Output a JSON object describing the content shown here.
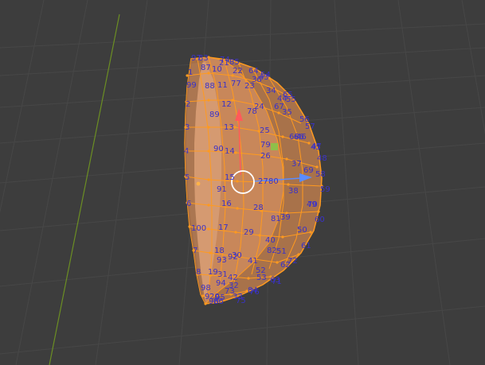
{
  "viewport": {
    "background": "#3d3d3d",
    "grid_color": "#474747",
    "y_axis_color": "#6b8e23",
    "mesh_face_color": "#c8875a",
    "mesh_edge_color": "#ff9a1f",
    "index_label_color": "#3a32c8"
  },
  "gizmo": {
    "y_arrow_color": "#ff5a5a",
    "x_arrow_color": "#5a8cff",
    "z_handle_color": "#8fbf4a",
    "cursor_ring_color": "#ffffff"
  },
  "labels": [
    {
      "t": "87"
    },
    {
      "t": "10"
    },
    {
      "t": "22"
    },
    {
      "t": "99"
    },
    {
      "t": "88"
    },
    {
      "t": "11"
    },
    {
      "t": "77"
    },
    {
      "t": "23"
    },
    {
      "t": "36"
    },
    {
      "t": "2"
    },
    {
      "t": "12"
    },
    {
      "t": "24"
    },
    {
      "t": "78"
    },
    {
      "t": "34"
    },
    {
      "t": "67"
    },
    {
      "t": "35"
    },
    {
      "t": "89"
    },
    {
      "t": "3"
    },
    {
      "t": "13"
    },
    {
      "t": "25"
    },
    {
      "t": "56"
    },
    {
      "t": "57"
    },
    {
      "t": "68"
    },
    {
      "t": "4"
    },
    {
      "t": "90"
    },
    {
      "t": "14"
    },
    {
      "t": "79"
    },
    {
      "t": "26"
    },
    {
      "t": "47"
    },
    {
      "t": "48"
    },
    {
      "t": "37"
    },
    {
      "t": "5"
    },
    {
      "t": "15"
    },
    {
      "t": "27"
    },
    {
      "t": "80"
    },
    {
      "t": "58"
    },
    {
      "t": "69"
    },
    {
      "t": "91"
    },
    {
      "t": "38"
    },
    {
      "t": "59"
    },
    {
      "t": "6"
    },
    {
      "t": "16"
    },
    {
      "t": "70"
    },
    {
      "t": "28"
    },
    {
      "t": "81"
    },
    {
      "t": "39"
    },
    {
      "t": "60"
    },
    {
      "t": "100"
    },
    {
      "t": "17"
    },
    {
      "t": "29"
    },
    {
      "t": "50"
    },
    {
      "t": "40"
    },
    {
      "t": "7"
    },
    {
      "t": "18"
    },
    {
      "t": "82"
    },
    {
      "t": "51"
    },
    {
      "t": "61"
    },
    {
      "t": "30"
    },
    {
      "t": "93"
    },
    {
      "t": "41"
    },
    {
      "t": "72"
    },
    {
      "t": "8"
    },
    {
      "t": "19"
    },
    {
      "t": "31"
    },
    {
      "t": "42"
    },
    {
      "t": "52"
    },
    {
      "t": "62"
    },
    {
      "t": "53"
    },
    {
      "t": "63"
    },
    {
      "t": "94"
    },
    {
      "t": "32"
    },
    {
      "t": "98"
    },
    {
      "t": "73"
    },
    {
      "t": "84"
    },
    {
      "t": "9"
    },
    {
      "t": "20"
    },
    {
      "t": "33"
    },
    {
      "t": "95"
    },
    {
      "t": "96"
    },
    {
      "t": "1"
    },
    {
      "t": "21"
    },
    {
      "t": "85"
    },
    {
      "t": "97"
    },
    {
      "t": "83"
    },
    {
      "t": "74"
    },
    {
      "t": "64"
    },
    {
      "t": "43"
    },
    {
      "t": "54"
    },
    {
      "t": "65"
    },
    {
      "t": "44"
    },
    {
      "t": "55"
    },
    {
      "t": "66"
    },
    {
      "t": "45"
    },
    {
      "t": "46"
    },
    {
      "t": "49"
    },
    {
      "t": "71"
    },
    {
      "t": "76"
    },
    {
      "t": "86"
    },
    {
      "t": "92"
    },
    {
      "t": "75"
    }
  ]
}
